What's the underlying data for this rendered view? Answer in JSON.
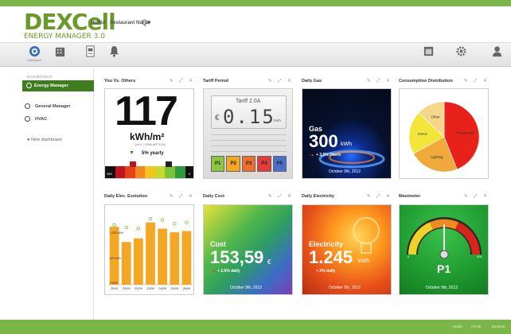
{
  "header": {
    "logo_main": "DEXCell",
    "logo_sub": "ENERGY MANAGER 3.0",
    "user": "NURIA",
    "place": "Restaurant Núria",
    "search_glyph": "Q▾"
  },
  "toolbar": {
    "dashboard_label": "Dashboard",
    "analysis_label": "",
    "reports_label": "",
    "alerts_label": "",
    "report2_label": "",
    "config_label": "",
    "user_label": ""
  },
  "sidebar": {
    "heading": "DASHBOARDS",
    "items": [
      {
        "label": "Energy Manager"
      },
      {
        "label": "General Manager"
      },
      {
        "label": "HVAC"
      }
    ],
    "new_dashboard": "New dashboard"
  },
  "widgets": {
    "you_vs_others": {
      "title": "You Vs. Others",
      "value": "117",
      "unit": "kWh/m²",
      "sub": "(AVG. CONSUMPTION)",
      "trend": "5% yearly",
      "scale_left": "360",
      "scale_right": "0"
    },
    "tariff": {
      "title": "Tariff Period",
      "tariff_name": "Tariff 2.0A",
      "display": "0.15",
      "currency": "€",
      "display_unit": "kWh",
      "periods": [
        "P1",
        "P2",
        "P3",
        "P4",
        "P5"
      ]
    },
    "daily_gas": {
      "title": "Daily Gas",
      "label": "Gas",
      "value": "300",
      "unit": "kWh",
      "change": "+ 3,5% Diario",
      "date": "October 9th, 2012"
    },
    "consumption": {
      "title": "Consumption Distribution"
    },
    "daily_elec": {
      "title": "Daily Elec. Evolution",
      "y_labels": [
        "1.000 kWh",
        "500 kWh",
        "0 kWh"
      ]
    },
    "daily_cost": {
      "title": "Daily Cost",
      "label": "Cost",
      "value": "153,59",
      "unit": "€",
      "change": "+ 2,5% daily",
      "date": "October 9th, 2012"
    },
    "daily_electricity": {
      "title": "Daily Electricity",
      "label": "Electricity",
      "value": "1.245",
      "unit": "kWh",
      "change": "+ 2% daily",
      "date": "October 9th, 2012"
    },
    "maximeter": {
      "title": "Maximeter",
      "period": "P1",
      "scale_min": "0",
      "scale_max": "200",
      "date": "October 9th, 2012"
    }
  },
  "chart_data": [
    {
      "type": "pie",
      "labels": [
        "Restaurant",
        "Lighting",
        "HVAC",
        "Other"
      ],
      "values": [
        44,
        23,
        20,
        13
      ],
      "colors": [
        "#e8221b",
        "#f0a93a",
        "#f4e53a",
        "#f5d78a"
      ]
    },
    {
      "type": "bar",
      "categories": [
        "20/09",
        "21/09",
        "22/09",
        "23/09",
        "24/09",
        "25/09",
        "26/09"
      ],
      "values": [
        950,
        700,
        760,
        1020,
        920,
        860,
        880
      ],
      "targets": [
        980,
        940,
        920,
        1080,
        1060,
        1000,
        1020
      ],
      "ylim": [
        0,
        1200
      ],
      "colors": {
        "bar": "#f3a725",
        "target": "#7ab648"
      }
    }
  ],
  "footer": {
    "copyright": "",
    "version": "",
    "help": "Ayuda",
    "about": "Cerrar",
    "export": "Exportar"
  },
  "colors": {
    "brand_green": "#7ab648",
    "dark_green": "#3f7d1f"
  }
}
